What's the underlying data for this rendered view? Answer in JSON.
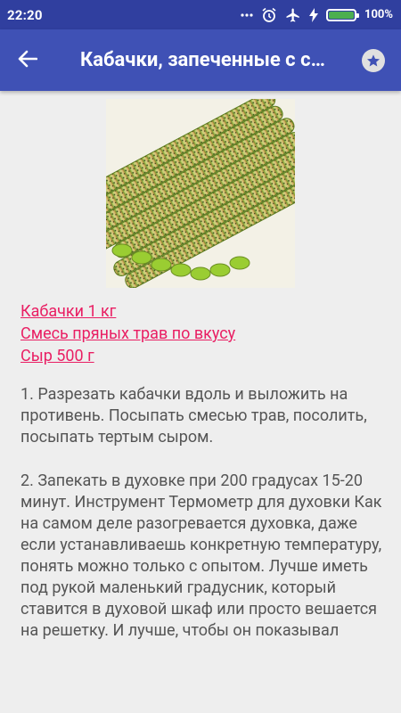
{
  "status_bar": {
    "time": "22:20",
    "icons": [
      "more-dots-icon",
      "alarm-icon",
      "airplane-icon",
      "charging-icon",
      "battery-icon"
    ],
    "battery_percent": "100%"
  },
  "app_bar": {
    "title": "Кабачки, запеченные с сыром",
    "back_icon": "arrow-back-icon",
    "favorite_icon": "star-icon"
  },
  "recipe": {
    "image_alt": "Запеченные кабачки",
    "ingredients": [
      "Кабачки 1 кг",
      "Смесь пряных трав по вкусу",
      "Сыр 500 г"
    ],
    "steps": [
      "1. Разрезать кабачки вдоль и выложить на противень. Посыпать смесью трав, посолить, посыпать тертым сыром.",
      "2. Запекать в духовке при 200 градусах 15-20 минут. Инструмент Термометр для духовки Как на самом деле разогревается духовка, даже если устанавливаешь конкретную температуру, понять можно только с опытом. Лучше иметь под рукой маленький градусник, который ставится в духовой шкаф или просто вешается на решетку. И лучше, чтобы он показывал"
    ]
  },
  "colors": {
    "status_bar": "#303f9f",
    "app_bar": "#3f51b5",
    "background": "#eeeeee",
    "link": "#e91e63",
    "body_text": "#555555"
  }
}
